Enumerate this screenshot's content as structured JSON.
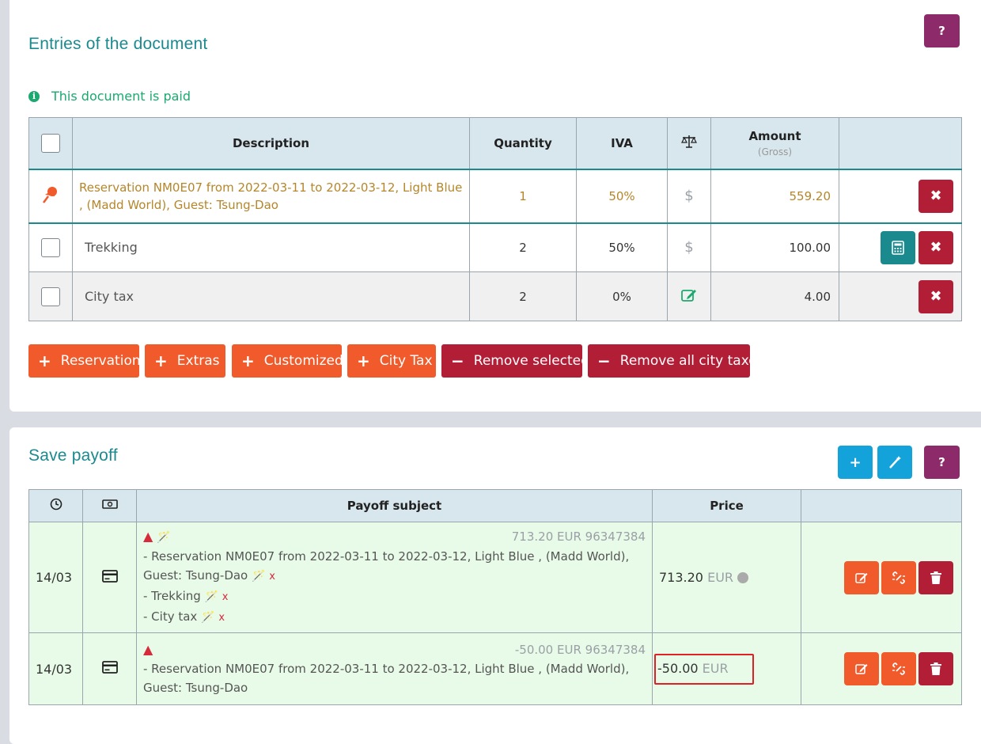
{
  "entries": {
    "title": "Entries of the document",
    "help_label": "?",
    "paid_notice": "This document is paid",
    "columns": {
      "description": "Description",
      "quantity": "Quantity",
      "iva": "IVA",
      "amount": "Amount",
      "amount_sub": "(Gross)"
    },
    "rows": [
      {
        "description": "Reservation NM0E07 from 2022-03-11 to 2022-03-12, Light Blue , (Madd World), Guest: Tsung-Dao",
        "quantity": "1",
        "iva": "50%",
        "tax_symbol": "$",
        "amount": "559.20"
      },
      {
        "description": "Trekking",
        "quantity": "2",
        "iva": "50%",
        "tax_symbol": "$",
        "amount": "100.00"
      },
      {
        "description": "City tax",
        "quantity": "2",
        "iva": "0%",
        "amount": "4.00"
      }
    ],
    "buttons": {
      "reservation": "Reservation",
      "extras": "Extras",
      "customized": "Customized",
      "city_tax": "City Tax",
      "remove_selected": "Remove selected",
      "remove_all_city_taxes": "Remove all city taxes"
    }
  },
  "payoff": {
    "title": "Save payoff",
    "help_label": "?",
    "columns": {
      "subject": "Payoff subject",
      "price": "Price"
    },
    "rows": [
      {
        "date": "14/03",
        "header_amount": "713.20 EUR 96347384",
        "lines": [
          "- Reservation NM0E07 from 2022-03-11 to 2022-03-12, Light Blue , (Madd World),",
          "Guest: Tsung-Dao",
          "- Trekking",
          "- City tax"
        ],
        "line_remove": "x",
        "price_value": "713.20",
        "price_currency": "EUR"
      },
      {
        "date": "14/03",
        "header_amount": "-50.00 EUR 96347384",
        "lines": [
          "- Reservation NM0E07 from 2022-03-11 to 2022-03-12, Light Blue , (Madd World),",
          "Guest: Tsung-Dao"
        ],
        "price_value": "-50.00",
        "price_currency": "EUR"
      }
    ]
  },
  "colors": {
    "accent_teal": "#1b8a8f",
    "paid_green": "#1ba96f",
    "reservation_text": "#b5862a",
    "danger": "#b31e37",
    "orange": "#f15a2b",
    "payoff_row_bg": "#e8fbe8",
    "highlight_border": "#e01f26"
  }
}
